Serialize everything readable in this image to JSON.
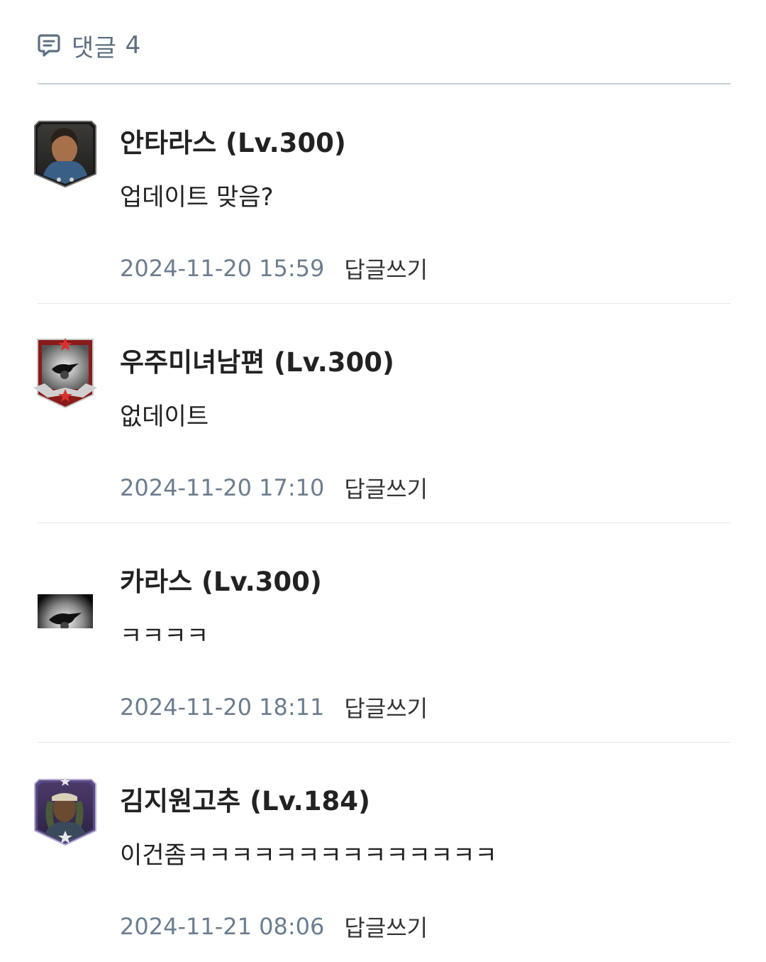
{
  "header": {
    "title": "댓글",
    "count": "4"
  },
  "comments": [
    {
      "author": "안타라스 (Lv.300)",
      "body": "업데이트 맞음?",
      "date": "2024-11-20 15:59",
      "reply": "답글쓰기",
      "avatar": "warrior-portrait"
    },
    {
      "author": "우주미녀남편 (Lv.300)",
      "body": "없데이트",
      "date": "2024-11-20 17:10",
      "reply": "답글쓰기",
      "avatar": "red-crow-emblem"
    },
    {
      "author": "카라스 (Lv.300)",
      "body": "ㅋㅋㅋㅋ",
      "date": "2024-11-20 18:11",
      "reply": "답글쓰기",
      "avatar": "crow-emblem"
    },
    {
      "author": "김지원고추 (Lv.184)",
      "body": "이건좀ㅋㅋㅋㅋㅋㅋㅋㅋㅋㅋㅋㅋㅋㅋ",
      "date": "2024-11-21 08:06",
      "reply": "답글쓰기",
      "avatar": "soldier-portrait"
    }
  ],
  "colors": {
    "meta_text": "#6c7d8e",
    "header_text": "#5f6f80",
    "divider": "#e3e6e9"
  }
}
